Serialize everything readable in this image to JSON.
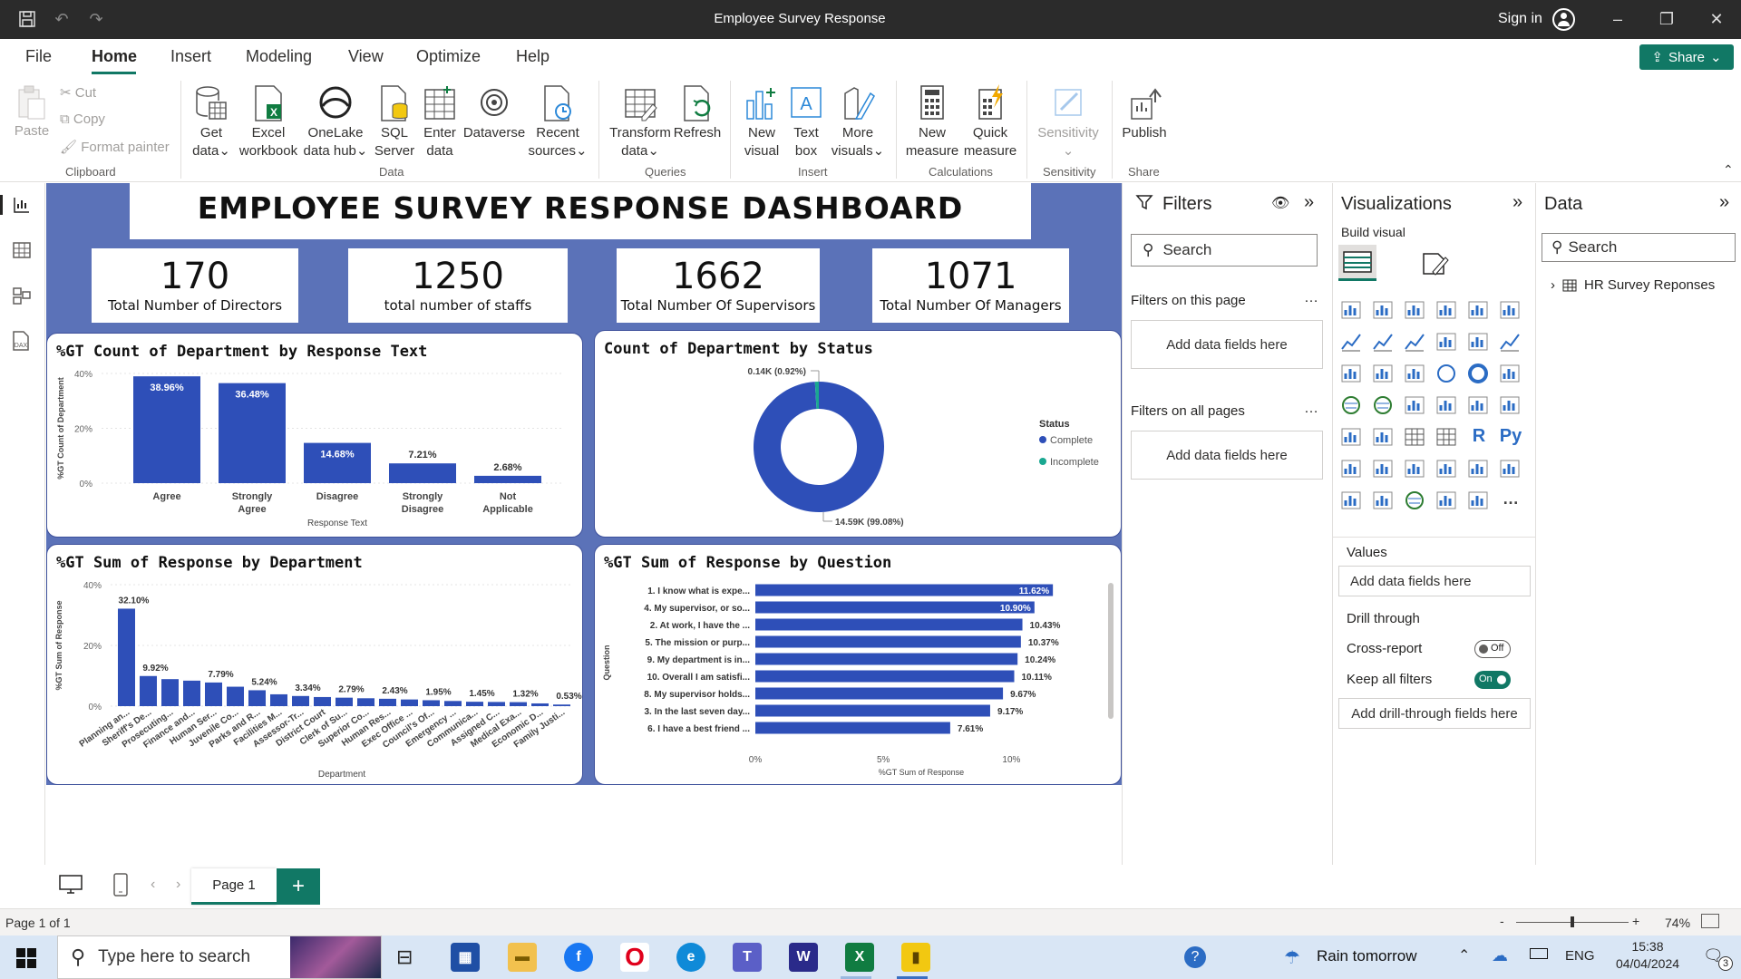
{
  "window": {
    "title": "Employee Survey Response",
    "sign_in": "Sign in"
  },
  "menu": {
    "file": "File",
    "home": "Home",
    "insert": "Insert",
    "modeling": "Modeling",
    "view": "View",
    "optimize": "Optimize",
    "help": "Help",
    "share": "Share"
  },
  "ribbon": {
    "clipboard": {
      "paste": "Paste",
      "cut": "Cut",
      "copy": "Copy",
      "format_painter": "Format painter",
      "group": "Clipboard"
    },
    "data": {
      "get_data": [
        "Get",
        "data"
      ],
      "excel": [
        "Excel",
        "workbook"
      ],
      "onelake": [
        "OneLake",
        "data hub"
      ],
      "sql": [
        "SQL",
        "Server"
      ],
      "enter": [
        "Enter",
        "data"
      ],
      "dataverse": "Dataverse",
      "recent": [
        "Recent",
        "sources"
      ],
      "group": "Data"
    },
    "queries": {
      "transform": [
        "Transform",
        "data"
      ],
      "refresh": "Refresh",
      "group": "Queries"
    },
    "insert": {
      "new_visual": [
        "New",
        "visual"
      ],
      "text_box": [
        "Text",
        "box"
      ],
      "more_visuals": [
        "More",
        "visuals"
      ],
      "group": "Insert"
    },
    "calculations": {
      "new_measure": [
        "New",
        "measure"
      ],
      "quick_measure": [
        "Quick",
        "measure"
      ],
      "group": "Calculations"
    },
    "sensitivity": {
      "label": "Sensitivity",
      "group": "Sensitivity"
    },
    "share": {
      "publish": "Publish",
      "group": "Share"
    }
  },
  "dashboard": {
    "title": "EMPLOYEE SURVEY RESPONSE DASHBOARD",
    "kpis": [
      {
        "value": "170",
        "label": "Total Number of Directors"
      },
      {
        "value": "1250",
        "label": "total number of staffs"
      },
      {
        "value": "1662",
        "label": "Total Number Of Supervisors"
      },
      {
        "value": "1071",
        "label": "Total Number Of Managers"
      }
    ]
  },
  "chart_data": [
    {
      "type": "bar",
      "title": "%GT Count of Department by Response Text",
      "xlabel": "Response Text",
      "ylabel": "%GT Count of Department",
      "categories": [
        "Agree",
        "Strongly Agree",
        "Disagree",
        "Strongly Disagree",
        "Not Applicable"
      ],
      "values": [
        38.96,
        36.48,
        14.68,
        7.21,
        2.68
      ],
      "data_labels": [
        "38.96%",
        "36.48%",
        "14.68%",
        "7.21%",
        "2.68%"
      ],
      "y_ticks": [
        "40%",
        "20%",
        "0%"
      ],
      "ylim": [
        0,
        40
      ],
      "color": "#2e4fb8"
    },
    {
      "type": "pie",
      "title": "Count of Department by Status",
      "legend_title": "Status",
      "legend_position": "right",
      "slices": [
        {
          "name": "Complete",
          "value": 14590,
          "label": "14.59K (99.08%)",
          "color": "#2e4fb8"
        },
        {
          "name": "Incomplete",
          "value": 140,
          "label": "0.14K (0.92%)",
          "color": "#1aa891"
        }
      ]
    },
    {
      "type": "bar",
      "title": "%GT Sum of Response by Department",
      "xlabel": "Department",
      "ylabel": "%GT Sum of Response",
      "categories": [
        "Planning an...",
        "Sheriff's De...",
        "Prosecuting...",
        "Finance and...",
        "Human Ser...",
        "Juvenile Co...",
        "Parks and R...",
        "Facilities M...",
        "Assessor-Tr...",
        "District Court",
        "Clerk of Su...",
        "Superior Co...",
        "Human Res...",
        "Exec Office ...",
        "Council's Of...",
        "Emergency ...",
        "Communica...",
        "Assigned C...",
        "Medical Exa...",
        "Economic D...",
        "Family Justi..."
      ],
      "values": [
        32.1,
        9.92,
        8.9,
        8.4,
        7.79,
        6.4,
        5.24,
        3.9,
        3.34,
        3.0,
        2.79,
        2.6,
        2.43,
        2.2,
        1.95,
        1.7,
        1.45,
        1.38,
        1.32,
        0.9,
        0.53
      ],
      "data_labels": [
        "32.10%",
        "9.92%",
        "",
        "",
        "7.79%",
        "",
        "5.24%",
        "",
        "3.34%",
        "",
        "2.79%",
        "",
        "2.43%",
        "",
        "1.95%",
        "",
        "1.45%",
        "",
        "1.32%",
        "",
        "0.53%"
      ],
      "y_ticks": [
        "40%",
        "20%",
        "0%"
      ],
      "ylim": [
        0,
        40
      ],
      "color": "#2e4fb8"
    },
    {
      "type": "bar",
      "orientation": "horizontal",
      "title": "%GT Sum of Response by Question",
      "xlabel": "%GT Sum of Response",
      "ylabel": "Question",
      "categories": [
        "1. I know what is expe...",
        "4. My supervisor, or so...",
        "2. At work, I have the ...",
        "5. The mission or purp...",
        "9. My department is in...",
        "10. Overall I am satisfi...",
        "8. My supervisor holds...",
        "3. In the last seven day...",
        "6. I have a best friend ..."
      ],
      "values": [
        11.62,
        10.9,
        10.43,
        10.37,
        10.24,
        10.11,
        9.67,
        9.17,
        7.61
      ],
      "data_labels": [
        "11.62%",
        "10.90%",
        "10.43%",
        "10.37%",
        "10.24%",
        "10.11%",
        "9.67%",
        "9.17%",
        "7.61%"
      ],
      "x_ticks": [
        "0%",
        "5%",
        "10%"
      ],
      "xlim": [
        0,
        12.5
      ],
      "color": "#2e4fb8"
    }
  ],
  "filters": {
    "title": "Filters",
    "search": "Search",
    "on_page": "Filters on this page",
    "on_all": "Filters on all pages",
    "add_fields": "Add data fields here"
  },
  "visualizations": {
    "title": "Visualizations",
    "build": "Build visual",
    "values": "Values",
    "add_fields": "Add data fields here",
    "drill": "Drill through",
    "cross_report": "Cross-report",
    "cross_state": "Off",
    "keep_filters": "Keep all filters",
    "keep_state": "On",
    "add_drill": "Add drill-through fields here"
  },
  "data": {
    "title": "Data",
    "search": "Search",
    "table": "HR Survey Reponses"
  },
  "pages": {
    "tab": "Page 1",
    "status": "Page 1 of 1",
    "zoom": "74%"
  },
  "taskbar": {
    "search": "Type here to search",
    "weather": "Rain tomorrow",
    "lang": "ENG",
    "time": "15:38",
    "date": "04/04/2024",
    "notif": "3"
  }
}
